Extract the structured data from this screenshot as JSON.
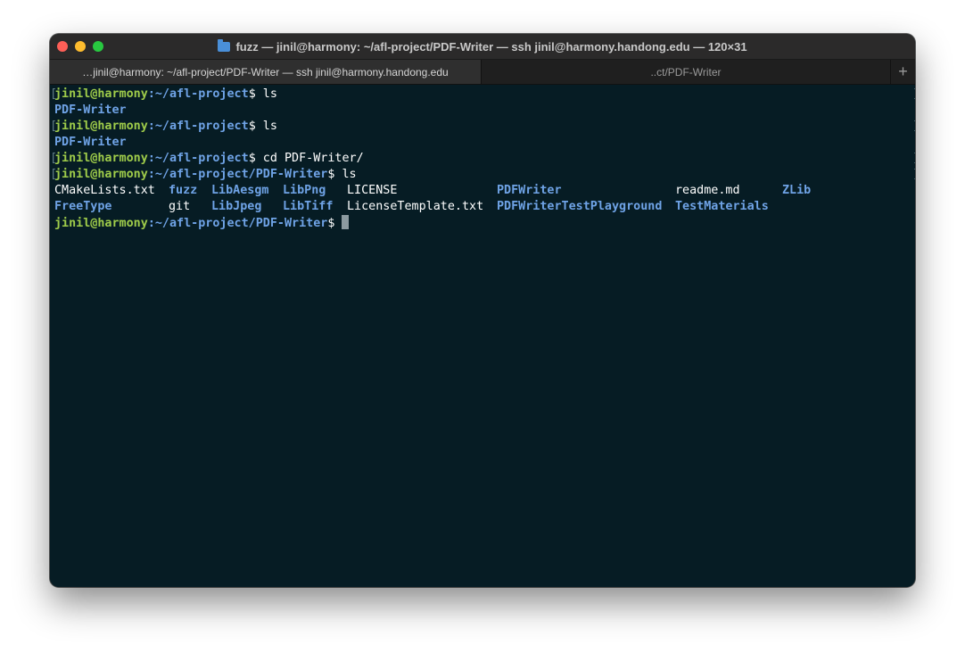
{
  "window": {
    "title": "fuzz — jinil@harmony: ~/afl-project/PDF-Writer — ssh jinil@harmony.handong.edu — 120×31",
    "title_icon": "folder-icon"
  },
  "tabs": [
    {
      "label": "…jinil@harmony: ~/afl-project/PDF-Writer — ssh jinil@harmony.handong.edu"
    },
    {
      "label": "..ct/PDF-Writer"
    }
  ],
  "tab_add": "+",
  "terminal": {
    "prompt_user": "jinil@harmony",
    "lines": [
      {
        "path": ":~/afl-project",
        "cmd": "$ ls"
      },
      {
        "out": "PDF-Writer"
      },
      {
        "path": ":~/afl-project",
        "cmd": "$ ls"
      },
      {
        "out": "PDF-Writer"
      },
      {
        "path": ":~/afl-project",
        "cmd": "$ cd PDF-Writer/"
      },
      {
        "path": ":~/afl-project/PDF-Writer",
        "cmd": "$ ls"
      }
    ],
    "ls_row1": [
      "CMakeLists.txt",
      "fuzz",
      "LibAesgm",
      "LibPng",
      "LICENSE",
      "PDFWriter",
      "readme.md",
      "ZLib"
    ],
    "ls_row2": [
      "FreeType",
      "git",
      "LibJpeg",
      "LibTiff",
      "LicenseTemplate.txt",
      "PDFWriterTestPlayground",
      "TestMaterials"
    ],
    "final_prompt": {
      "path": ":~/afl-project/PDF-Writer",
      "cmd": "$ "
    }
  },
  "colors": {
    "background": "#061c24",
    "user": "#9fcc4a",
    "path": "#6fa3e6",
    "text": "#ffffff"
  }
}
